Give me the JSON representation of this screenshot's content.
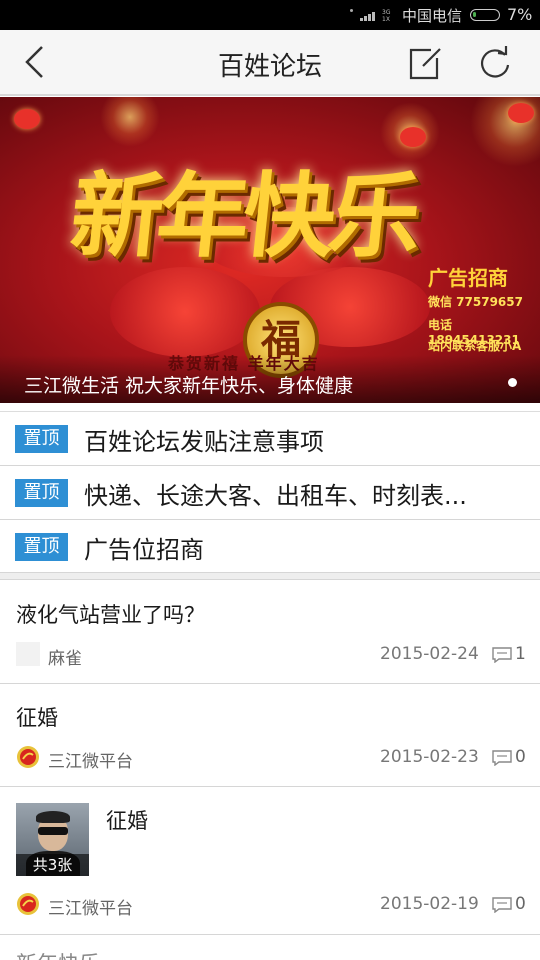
{
  "status_bar": {
    "network": "3G 1X",
    "carrier": "中国电信",
    "battery": "7%"
  },
  "header": {
    "title": "百姓论坛",
    "back_icon": "chevron-left-icon",
    "edit_icon": "compose-icon",
    "refresh_icon": "refresh-icon"
  },
  "banner": {
    "headline": "新年快乐",
    "fu": "福",
    "ad_title": "广告招商",
    "ad_wechat": "微信 77579657",
    "ad_phone": "电话 18945413231",
    "ad_contact": "站内联系客服小A",
    "slogan": "恭贺新禧  羊年大吉",
    "caption": "三江微生活   祝大家新年快乐、身体健康",
    "colors": {
      "primary": "#c8161d",
      "gold": "#ffd23a"
    }
  },
  "pinned": [
    {
      "tag": "置顶",
      "title": "百姓论坛发贴注意事项"
    },
    {
      "tag": "置顶",
      "title": "快递、长途大客、出租车、时刻表..."
    },
    {
      "tag": "置顶",
      "title": "广告位招商"
    }
  ],
  "posts": [
    {
      "title": "液化气站营业了吗？",
      "author": "麻雀",
      "date": "2015-02-24",
      "comments": "1"
    },
    {
      "title": "征婚",
      "author": "三江微平台",
      "date": "2015-02-23",
      "comments": "0"
    },
    {
      "title": "征婚",
      "author": "三江微平台",
      "date": "2015-02-19",
      "comments": "0",
      "image_count": "共3张"
    }
  ],
  "next_post_peek": "新年快乐"
}
